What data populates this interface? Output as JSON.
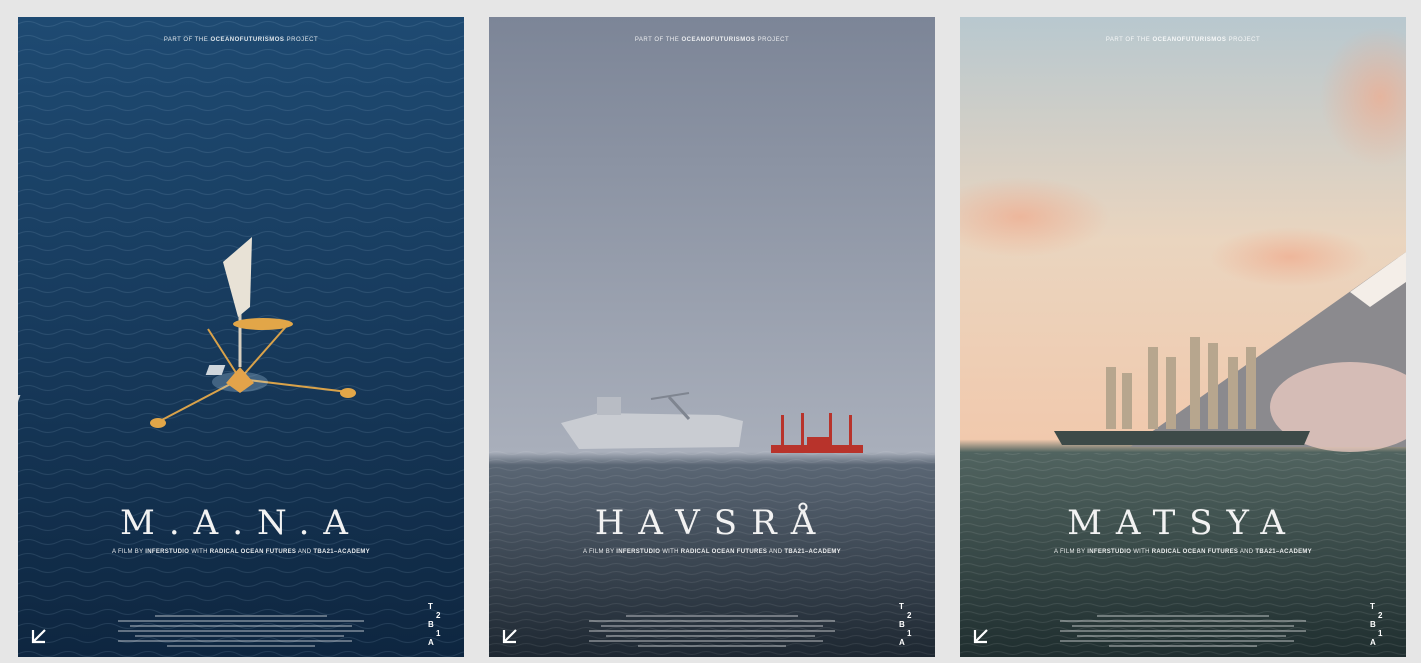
{
  "posters": [
    {
      "header_prefix": "PART OF THE",
      "header_project": "OCEANOFUTURISMOS",
      "header_suffix": "PROJECT",
      "title": "M.A.N.A",
      "subtitle_prefix": "A FILM BY",
      "studio": "INFERSTUDIO",
      "subtitle_with": "WITH",
      "partner1": "RADICAL OCEAN FUTURES",
      "subtitle_and": "AND",
      "partner2": "TBA21–ACADEMY",
      "logo_icon": "arrow-logo-icon",
      "tba_letters": [
        "T",
        "2",
        "B",
        "1",
        "A"
      ]
    },
    {
      "header_prefix": "PART OF THE",
      "header_project": "OCEANOFUTURISMOS",
      "header_suffix": "PROJECT",
      "title": "HAVSRÅ",
      "subtitle_prefix": "A FILM BY",
      "studio": "INFERSTUDIO",
      "subtitle_with": "WITH",
      "partner1": "RADICAL OCEAN FUTURES",
      "subtitle_and": "AND",
      "partner2": "TBA21–ACADEMY",
      "logo_icon": "arrow-logo-icon",
      "tba_letters": [
        "T",
        "2",
        "B",
        "1",
        "A"
      ]
    },
    {
      "header_prefix": "PART OF THE",
      "header_project": "OCEANOFUTURISMOS",
      "header_suffix": "PROJECT",
      "title": "MATSYA",
      "subtitle_prefix": "A FILM BY",
      "studio": "INFERSTUDIO",
      "subtitle_with": "WITH",
      "partner1": "RADICAL OCEAN FUTURES",
      "subtitle_and": "AND",
      "partner2": "TBA21–ACADEMY",
      "logo_icon": "arrow-logo-icon",
      "tba_letters": [
        "T",
        "2",
        "B",
        "1",
        "A"
      ]
    }
  ],
  "colors": {
    "page_background": "#e6e6e6",
    "mana_ocean": "#173a5c",
    "havsra_sky": "#8e96a6",
    "matsya_sky": "#e8cfb4"
  }
}
